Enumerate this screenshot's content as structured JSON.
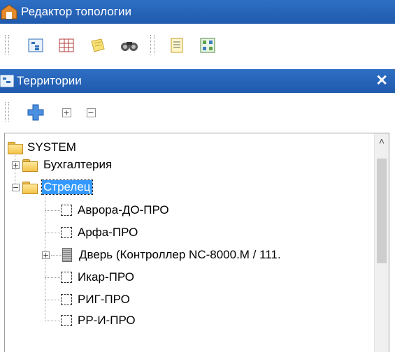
{
  "window": {
    "title": "Редактор топологии"
  },
  "panel": {
    "title": "Территории",
    "close_glyph": "✕"
  },
  "toolbar_icons": [
    "tree-view-icon",
    "grid-icon",
    "notes-icon",
    "binoculars-icon",
    "report-icon",
    "map-icon"
  ],
  "panel_toolbar": {
    "add_glyph": "✚",
    "expand_all_glyph": "+",
    "collapse_all_glyph": "−"
  },
  "tree": {
    "root": "SYSTEM",
    "items": [
      {
        "label": "Бухгалтерия",
        "expander": "+"
      },
      {
        "label": "Стрелец",
        "expander": "−",
        "selected": true,
        "children": [
          {
            "label": "Аврора-ДО-ПРО"
          },
          {
            "label": "Арфа-ПРО"
          },
          {
            "label": "Дверь (Контроллер NC-8000.M / 111.",
            "expander": "+"
          },
          {
            "label": "Икар-ПРО"
          },
          {
            "label": "РИГ-ПРО"
          },
          {
            "label": "РР-И-ПРО"
          }
        ]
      }
    ]
  },
  "colors": {
    "titlebar": "#1f5aad",
    "selection": "#3399ff",
    "folder": "#f3c348"
  }
}
